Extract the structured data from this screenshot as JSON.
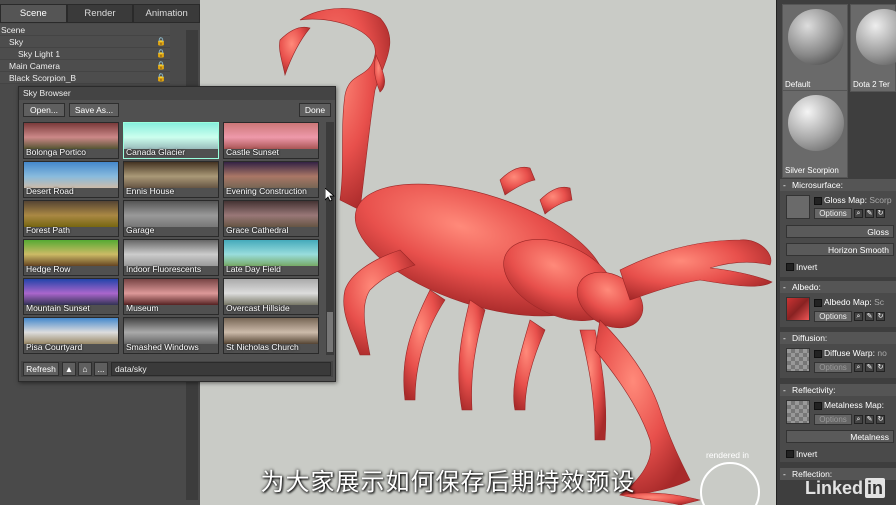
{
  "tabs": [
    "Scene",
    "Render",
    "Animation"
  ],
  "scene_tree": [
    "Scene",
    "Sky",
    "Sky Light 1",
    "Main Camera",
    "Black Scorpion_B"
  ],
  "sky_browser": {
    "title": "Sky Browser",
    "open_label": "Open...",
    "save_as_label": "Save As...",
    "done_label": "Done",
    "refresh_label": "Refresh",
    "up_icon": "up-arrow-icon",
    "home_icon": "home-icon",
    "more_label": "...",
    "path": "data/sky",
    "skies": [
      {
        "name": "Bolonga Portico",
        "colors": [
          "#7a3a3a",
          "#c88",
          "#553"
        ]
      },
      {
        "name": "Canada Glacier",
        "colors": [
          "#8ed",
          "#cfe",
          "#9bb"
        ]
      },
      {
        "name": "Castle Sunset",
        "colors": [
          "#c77",
          "#e9a",
          "#a55"
        ]
      },
      {
        "name": "Desert Road",
        "colors": [
          "#48c",
          "#8bd",
          "#cba"
        ]
      },
      {
        "name": "Ennis House",
        "colors": [
          "#432",
          "#a97",
          "#654"
        ]
      },
      {
        "name": "Evening Construction",
        "colors": [
          "#324",
          "#a76",
          "#765"
        ]
      },
      {
        "name": "Forest Path",
        "colors": [
          "#543",
          "#a84",
          "#761"
        ]
      },
      {
        "name": "Garage",
        "colors": [
          "#555",
          "#999",
          "#777"
        ]
      },
      {
        "name": "Grace Cathedral",
        "colors": [
          "#433",
          "#977",
          "#654"
        ]
      },
      {
        "name": "Hedge Row",
        "colors": [
          "#5a3",
          "#cb6",
          "#642"
        ]
      },
      {
        "name": "Indoor Fluorescents",
        "colors": [
          "#666",
          "#ccc",
          "#999"
        ]
      },
      {
        "name": "Late Day Field",
        "colors": [
          "#4ab",
          "#9dd",
          "#7a6"
        ]
      },
      {
        "name": "Mountain Sunset",
        "colors": [
          "#24a",
          "#a6c",
          "#335"
        ]
      },
      {
        "name": "Museum",
        "colors": [
          "#744",
          "#d99",
          "#522"
        ]
      },
      {
        "name": "Overcast Hillside",
        "colors": [
          "#aaa",
          "#ddd",
          "#776"
        ]
      },
      {
        "name": "Pisa Courtyard",
        "colors": [
          "#48c",
          "#ddd",
          "#986"
        ]
      },
      {
        "name": "Smashed Windows",
        "colors": [
          "#444",
          "#aaa",
          "#666"
        ]
      },
      {
        "name": "St Nicholas Church",
        "colors": [
          "#765",
          "#cba",
          "#543"
        ]
      }
    ]
  },
  "materials": [
    {
      "name": "Default",
      "color": "#999"
    },
    {
      "name": "Dota 2 Ter",
      "color": "#aaa"
    },
    {
      "name": "Silver Scorpion",
      "color": "#bbb"
    }
  ],
  "sections": {
    "microsurface": {
      "title": "Microsurface:",
      "map_label": "Gloss Map:",
      "map_value": "Scorp",
      "options_label": "Options",
      "gloss_label": "Gloss",
      "horizon_label": "Horizon Smooth",
      "invert_label": "Invert"
    },
    "albedo": {
      "title": "Albedo:",
      "map_label": "Albedo Map:",
      "map_value": "Sc",
      "options_label": "Options"
    },
    "diffusion": {
      "title": "Diffusion:",
      "map_label": "Diffuse Warp:",
      "map_value": "no",
      "options_label": "Options"
    },
    "reflectivity": {
      "title": "Reflectivity:",
      "map_label": "Metalness Map:",
      "options_label": "Options",
      "metalness_label": "Metalness",
      "invert_label": "Invert"
    },
    "reflection": {
      "title": "Reflection:"
    }
  },
  "viewport": {
    "rendered_in": "rendered in",
    "background": "#c9cbc6",
    "scorpion_color": "#e8504c"
  },
  "subtitle": "为大家展示如何保存后期特效预设",
  "watermark": "Linked",
  "watermark_in": "in"
}
